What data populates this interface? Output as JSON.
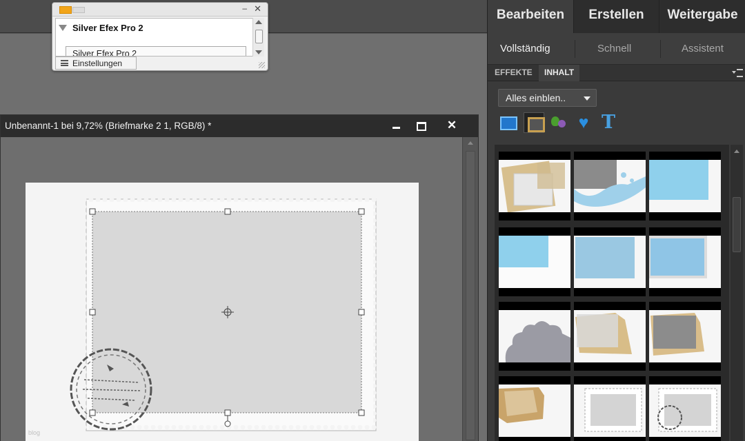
{
  "plugin_panel": {
    "heading": "Silver Efex Pro 2",
    "item": "Silver Efex Pro 2",
    "tab_label": "Einstellungen",
    "minimize_glyph": "–",
    "close_glyph": "✕"
  },
  "document": {
    "title": "Unbenannt-1 bei 9,72% (Briefmarke 2 1, RGB/8) *",
    "close_glyph": "✕",
    "watermark": "blog"
  },
  "right_panel": {
    "main_tabs": [
      "Bearbeiten",
      "Erstellen",
      "Weitergabe"
    ],
    "mode_tabs": [
      "Vollständig",
      "Schnell",
      "Assistent"
    ],
    "panel_tabs": [
      "EFFEKTE",
      "INHALT"
    ],
    "dropdown_value": "Alles einblen..",
    "category_icons": [
      "background-icon",
      "frame-icon",
      "graphic-icon",
      "shape-heart-icon",
      "text-icon"
    ],
    "heart_glyph": "♥",
    "text_glyph": "T"
  },
  "colors": {
    "panel_dark": "#3a3a3a",
    "accent_blue": "#8fd0ec",
    "frame_tan": "#d8bd88"
  }
}
